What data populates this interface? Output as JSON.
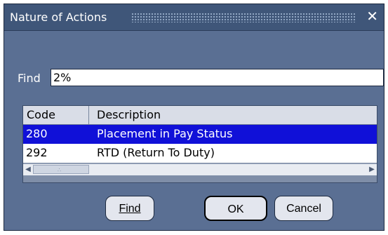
{
  "window": {
    "title": "Nature of Actions",
    "close_glyph": "✕"
  },
  "find": {
    "label": "Find",
    "value": "2%"
  },
  "list": {
    "columns": [
      "Code",
      "Description"
    ],
    "rows": [
      {
        "code": "280",
        "description": "Placement in Pay Status",
        "selected": true
      },
      {
        "code": "292",
        "description": "RTD (Return To Duty)",
        "selected": false
      }
    ],
    "selection_color": "#1010d8"
  },
  "buttons": {
    "find_label": "Find",
    "ok_label": "OK",
    "cancel_label": "Cancel"
  },
  "colors": {
    "window_bg": "#5a6f93",
    "titlebar_bg": "#3f5679"
  },
  "icons": {
    "scroll_left": "left-arrow-icon",
    "scroll_right": "right-arrow-icon"
  }
}
